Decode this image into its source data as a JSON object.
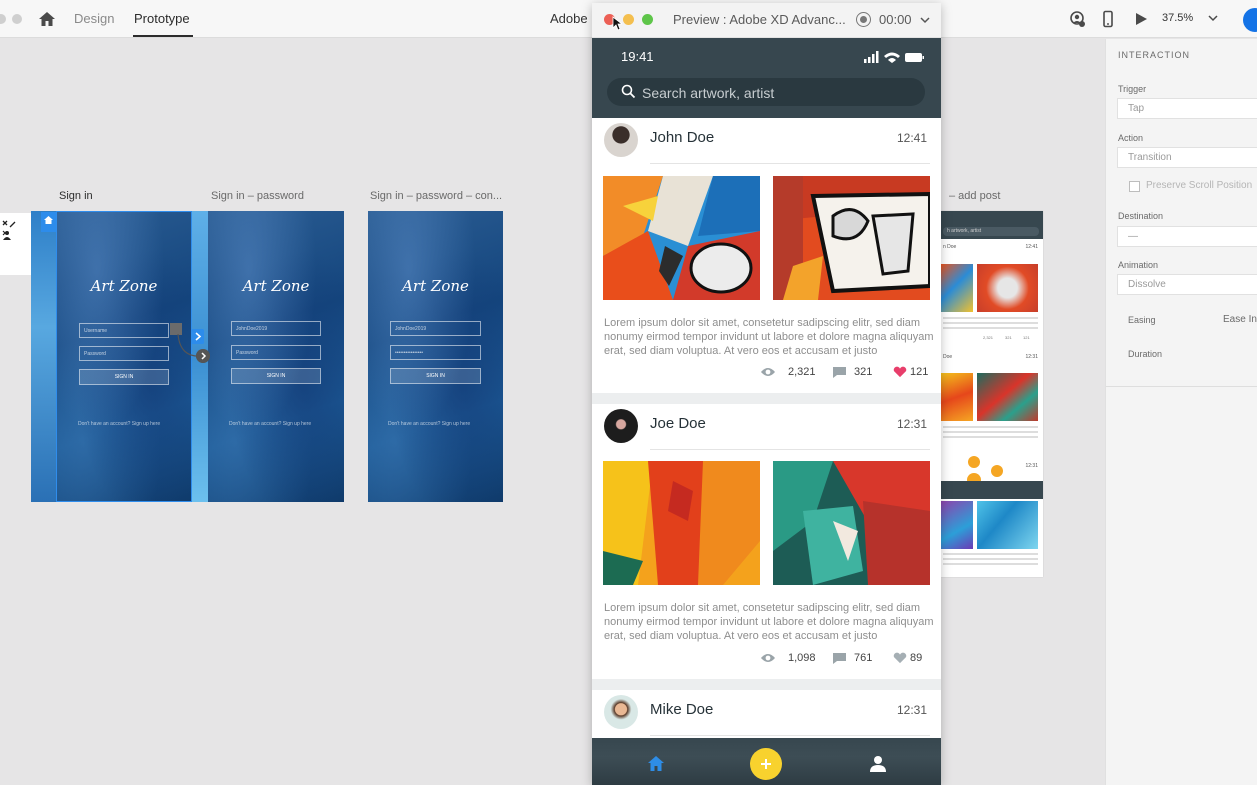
{
  "topbar": {
    "tabs": [
      {
        "label": "Design",
        "active": false
      },
      {
        "label": "Prototype",
        "active": true
      }
    ],
    "doc_title": "Adobe",
    "zoom": "37.5%",
    "icons": [
      "home-icon",
      "share-icon",
      "device-preview-icon",
      "play-icon",
      "chevron-down-icon"
    ]
  },
  "artboards": [
    {
      "title": "Sign in",
      "app_name": "Art Zone",
      "field1": "Username",
      "field2": "Password",
      "button": "SIGN IN",
      "footer": "Don't have an account? Sign up here"
    },
    {
      "title": "Sign in – password",
      "app_name": "Art Zone",
      "field1": "JohnDoe2019",
      "field2": "Password",
      "button": "SIGN IN",
      "footer": "Don't have an account? Sign up here"
    },
    {
      "title": "Sign in – password – con...",
      "app_name": "Art Zone",
      "field1": "JohnDoe2019",
      "field2": "••••••••••••••••",
      "button": "SIGN IN",
      "footer": "Don't have an account? Sign up here"
    },
    {
      "title": "– add post",
      "search": "h artwork, artist",
      "rows": [
        {
          "name": "n Doe",
          "time": "12:41"
        },
        {
          "name": "Doe",
          "time": "12:31"
        },
        {
          "name": "",
          "time": "12:31"
        }
      ],
      "stats": [
        "2,321",
        "321",
        "121"
      ]
    }
  ],
  "inspector": {
    "title": "INTERACTION",
    "trigger_label": "Trigger",
    "trigger_value": "Tap",
    "action_label": "Action",
    "action_value": "Transition",
    "preserve_scroll": "Preserve Scroll Position",
    "destination_label": "Destination",
    "destination_value": "—",
    "animation_label": "Animation",
    "animation_value": "Dissolve",
    "easing_label": "Easing",
    "easing_value": "Ease In",
    "duration_label": "Duration"
  },
  "preview": {
    "title": "Preview : Adobe XD Advanc...",
    "time": "00:00",
    "phone": {
      "clock": "19:41",
      "search_placeholder": "Search artwork, artist",
      "posts": [
        {
          "user": "John Doe",
          "time": "12:41",
          "text": "Lorem ipsum dolor sit amet, consetetur sadipscing elitr, sed diam nonumy eirmod tempor invidunt ut labore et dolore magna aliquyam erat, sed diam voluptua. At vero eos et accusam et justo",
          "views": "2,321",
          "comments": "321",
          "likes": "121",
          "liked": true
        },
        {
          "user": "Joe Doe",
          "time": "12:31",
          "text": "Lorem ipsum dolor sit amet, consetetur sadipscing elitr, sed diam nonumy eirmod tempor invidunt ut labore et dolore magna aliquyam erat, sed diam voluptua. At vero eos et accusam et justo",
          "views": "1,098",
          "comments": "761",
          "likes": "89",
          "liked": false
        },
        {
          "user": "Mike Doe",
          "time": "12:31"
        }
      ],
      "nav": [
        "home-icon",
        "add-icon",
        "profile-icon"
      ]
    }
  },
  "colors": {
    "accent": "#1473e6",
    "phone_header": "#37474f",
    "fab": "#f8d22e",
    "like": "#e83e6b"
  }
}
